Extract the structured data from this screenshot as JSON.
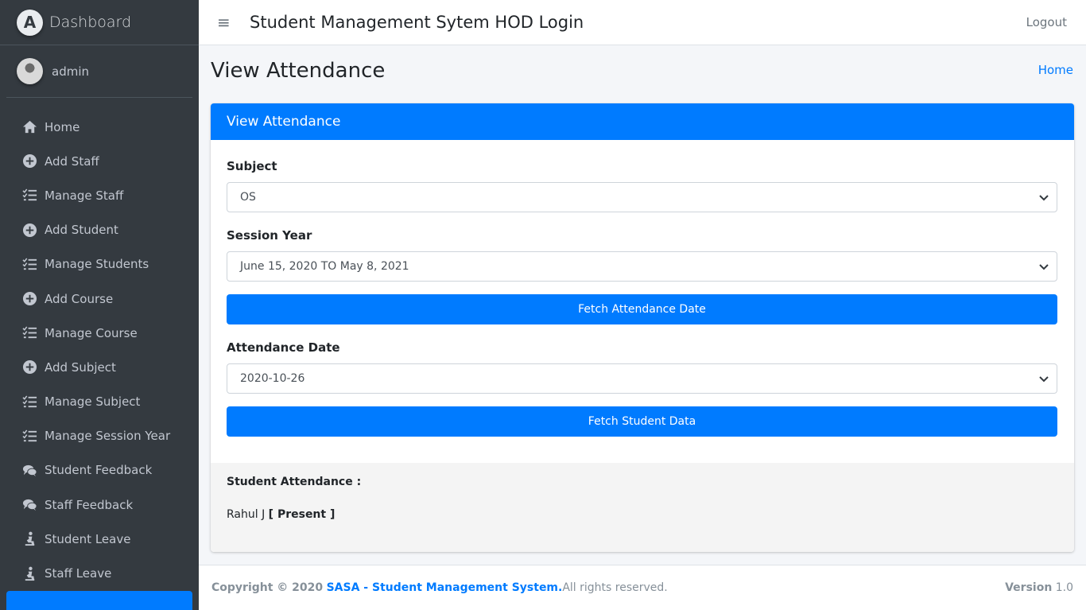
{
  "brand": {
    "logo_letter": "A",
    "name": "Dashboard"
  },
  "user": {
    "name": "admin"
  },
  "sidebar": {
    "items": [
      {
        "label": "Home",
        "icon": "home-icon"
      },
      {
        "label": "Add Staff",
        "icon": "plus-circle-icon"
      },
      {
        "label": "Manage Staff",
        "icon": "list-check-icon"
      },
      {
        "label": "Add Student",
        "icon": "plus-circle-icon"
      },
      {
        "label": "Manage Students",
        "icon": "list-check-icon"
      },
      {
        "label": "Add Course",
        "icon": "plus-circle-icon"
      },
      {
        "label": "Manage Course",
        "icon": "list-check-icon"
      },
      {
        "label": "Add Subject",
        "icon": "plus-circle-icon"
      },
      {
        "label": "Manage Subject",
        "icon": "list-check-icon"
      },
      {
        "label": "Manage Session Year",
        "icon": "list-check-icon"
      },
      {
        "label": "Student Feedback",
        "icon": "comments-icon"
      },
      {
        "label": "Staff Feedback",
        "icon": "comments-icon"
      },
      {
        "label": "Student Leave",
        "icon": "person-kneel-icon"
      },
      {
        "label": "Staff Leave",
        "icon": "person-kneel-icon"
      }
    ]
  },
  "header": {
    "title": "Student Management Sytem HOD Login",
    "logout": "Logout"
  },
  "page": {
    "title": "View Attendance",
    "breadcrumb": "Home"
  },
  "card": {
    "header": "View Attendance",
    "subject_label": "Subject",
    "subject_value": "OS",
    "session_label": "Session Year",
    "session_value": "June 15, 2020 TO May 8, 2021",
    "fetch_date_button": "Fetch Attendance Date",
    "date_label": "Attendance Date",
    "date_value": "2020-10-26",
    "fetch_student_button": "Fetch Student Data"
  },
  "attendance": {
    "label": "Student Attendance :",
    "records": [
      {
        "name": "Rahul J",
        "status": "[ Present ]"
      }
    ]
  },
  "footer": {
    "copyright": "Copyright © 2020",
    "link": "SASA - Student Management System.",
    "rights": " All rights reserved.",
    "version_label": "Version",
    "version_value": " 1.0"
  },
  "colors": {
    "primary": "#007bff",
    "sidebar": "#343a40"
  }
}
